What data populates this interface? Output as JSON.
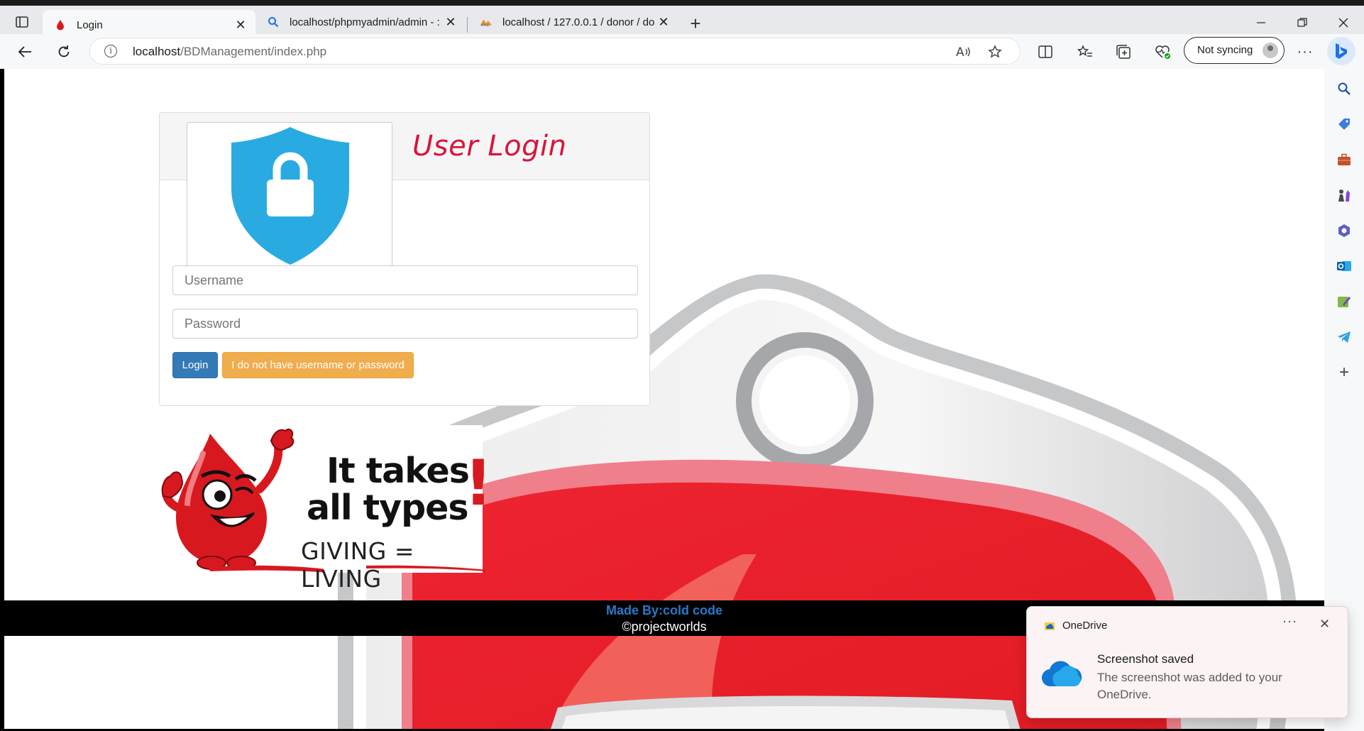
{
  "browser": {
    "tabs": [
      {
        "title": "Login",
        "active": true
      },
      {
        "title": "localhost/phpmyadmin/admin - :",
        "active": false
      },
      {
        "title": "localhost / 127.0.0.1 / donor / do",
        "active": false
      }
    ],
    "url_host": "localhost",
    "url_path": "/BDManagement/index.php",
    "sync_label": "Not syncing"
  },
  "sidebar": {
    "icons": [
      "search-icon",
      "tag-icon",
      "briefcase-icon",
      "chess-icon",
      "copilot-icon",
      "outlook-icon",
      "designer-icon",
      "telegram-icon",
      "add-icon"
    ]
  },
  "login": {
    "title": "User Login",
    "username_placeholder": "Username",
    "password_placeholder": "Password",
    "login_label": "Login",
    "forgot_label": "I do not have username or password"
  },
  "promo": {
    "line1": "It takes",
    "line2": "all types",
    "exclaim": "!",
    "tagline": "GIVING = LIVING"
  },
  "footer": {
    "made_by": "Made By:cold code",
    "copyright": "©projectworlds"
  },
  "toast": {
    "app": "OneDrive",
    "more": "···",
    "close": "✕",
    "heading": "Screenshot saved",
    "body": "The screenshot was added to your OneDrive."
  },
  "colors": {
    "title_red": "#d9143b",
    "login_blue": "#337ab7",
    "forgot_orange": "#f0ad4e",
    "shield_blue": "#29abe2",
    "footer_link": "#2a78c9"
  }
}
